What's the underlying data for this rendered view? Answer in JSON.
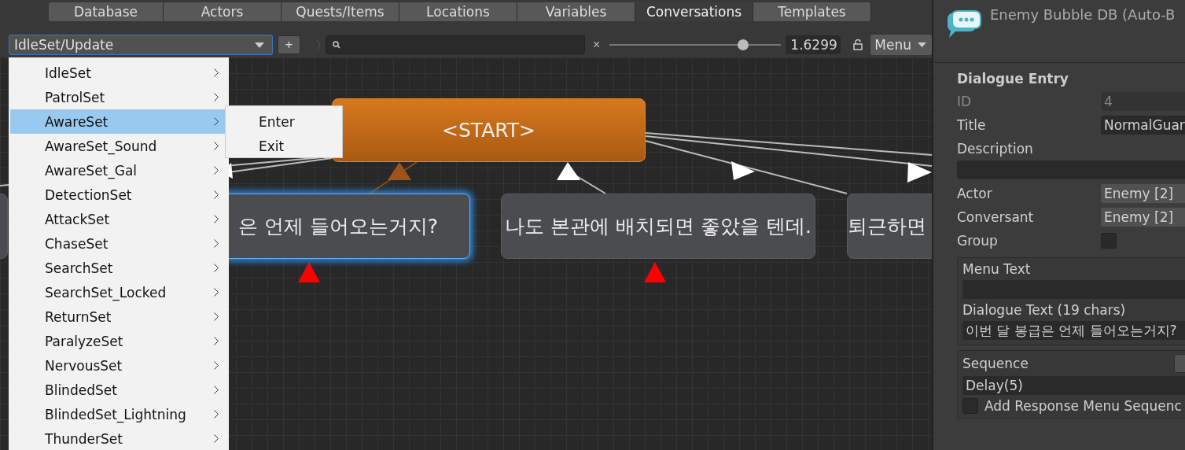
{
  "tabs": [
    {
      "label": "Database",
      "selected": false
    },
    {
      "label": "Actors",
      "selected": false
    },
    {
      "label": "Quests/Items",
      "selected": false
    },
    {
      "label": "Locations",
      "selected": false
    },
    {
      "label": "Variables",
      "selected": false
    },
    {
      "label": "Conversations",
      "selected": true
    },
    {
      "label": "Templates",
      "selected": false
    }
  ],
  "toolbar": {
    "conversation": "IdleSet/Update",
    "add_button": "+",
    "clear_button": "×",
    "zoom": {
      "level": 0.78
    },
    "zoom_value": "1.6299",
    "menu_button": "Menu"
  },
  "conversation_menu": {
    "items": [
      {
        "label": "IdleSet",
        "selected": false
      },
      {
        "label": "PatrolSet",
        "selected": false
      },
      {
        "label": "AwareSet",
        "selected": true
      },
      {
        "label": "AwareSet_Sound",
        "selected": false
      },
      {
        "label": "AwareSet_Gal",
        "selected": false
      },
      {
        "label": "DetectionSet",
        "selected": false
      },
      {
        "label": "AttackSet",
        "selected": false
      },
      {
        "label": "ChaseSet",
        "selected": false
      },
      {
        "label": "SearchSet",
        "selected": false
      },
      {
        "label": "SearchSet_Locked",
        "selected": false
      },
      {
        "label": "ReturnSet",
        "selected": false
      },
      {
        "label": "ParalyzeSet",
        "selected": false
      },
      {
        "label": "NervousSet",
        "selected": false
      },
      {
        "label": "BlindedSet",
        "selected": false
      },
      {
        "label": "BlindedSet_Lightning",
        "selected": false
      },
      {
        "label": "ThunderSet",
        "selected": false
      }
    ],
    "submenu": [
      {
        "label": "Enter",
        "selected": false
      },
      {
        "label": "Exit",
        "selected": false
      }
    ]
  },
  "canvas": {
    "nodes": [
      {
        "kind": "start",
        "text": "<START>",
        "selected": false
      },
      {
        "kind": "entry",
        "text": "은 언제 들어오는거지?",
        "selected": true
      },
      {
        "kind": "entry",
        "text": "나도 본관에 배치되면 좋았을 텐데.",
        "selected": false
      },
      {
        "kind": "entry",
        "text": "퇴근하면",
        "selected": false
      },
      {
        "kind": "entry",
        "selected": false
      }
    ]
  },
  "inspector": {
    "title": "Enemy Bubble DB (Auto-B",
    "section": "Dialogue Entry",
    "fields": [
      {
        "kind": "text",
        "label": "ID",
        "value": "4",
        "disabled": true
      },
      {
        "kind": "text",
        "label": "Title",
        "value": "NormalGuar",
        "disabled": false
      },
      {
        "kind": "wide",
        "label": "Description",
        "disabled": false
      },
      {
        "kind": "popup",
        "label": "Actor",
        "value": "Enemy [2]",
        "disabled": false
      },
      {
        "kind": "popup",
        "label": "Conversant",
        "value": "Enemy [2]",
        "disabled": false
      },
      {
        "kind": "check",
        "label": "Group",
        "checked": false,
        "disabled": false
      }
    ],
    "menu_text_group": {
      "menu_text_label": "Menu Text",
      "dialogue_text_label": "Dialogue Text (19 chars)",
      "dialogue_text": "이번 달 봉급은 언제 들어오는거지?"
    },
    "sequence_group": {
      "label": "Sequence",
      "value": "Delay(5)",
      "add_response_label": "Add Response Menu Sequenc",
      "add_response_checked": false
    }
  }
}
